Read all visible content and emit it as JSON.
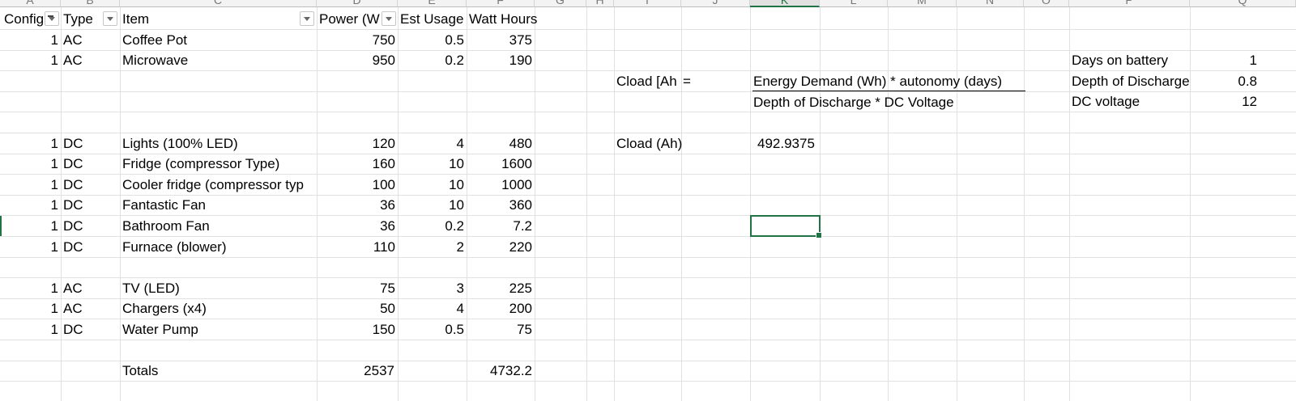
{
  "column_letters": [
    "A",
    "B",
    "C",
    "D",
    "E",
    "F",
    "G",
    "H",
    "I",
    "J",
    "K",
    "L",
    "M",
    "N",
    "O",
    "P",
    "Q"
  ],
  "headers": {
    "config": "Config",
    "type": "Type",
    "item": "Item",
    "power": "Power (W",
    "est_usage": "Est Usage",
    "watt_hours": "Watt Hours"
  },
  "items_table": [
    {
      "config": "1",
      "type": "AC",
      "item": "Coffee Pot",
      "power": "750",
      "usage": "0.5",
      "wh": "375"
    },
    {
      "config": "1",
      "type": "AC",
      "item": "Microwave",
      "power": "950",
      "usage": "0.2",
      "wh": "190"
    },
    {
      "config": "1",
      "type": "DC",
      "item": "Lights (100% LED)",
      "power": "120",
      "usage": "4",
      "wh": "480"
    },
    {
      "config": "1",
      "type": "DC",
      "item": "Fridge (compressor Type)",
      "power": "160",
      "usage": "10",
      "wh": "1600"
    },
    {
      "config": "1",
      "type": "DC",
      "item": "Cooler fridge (compressor typ",
      "power": "100",
      "usage": "10",
      "wh": "1000"
    },
    {
      "config": "1",
      "type": "DC",
      "item": "Fantastic Fan",
      "power": "36",
      "usage": "10",
      "wh": "360"
    },
    {
      "config": "1",
      "type": "DC",
      "item": "Bathroom Fan",
      "power": "36",
      "usage": "0.2",
      "wh": "7.2"
    },
    {
      "config": "1",
      "type": "DC",
      "item": "Furnace (blower)",
      "power": "110",
      "usage": "2",
      "wh": "220"
    },
    {
      "config": "1",
      "type": "AC",
      "item": "TV (LED)",
      "power": "75",
      "usage": "3",
      "wh": "225"
    },
    {
      "config": "1",
      "type": "AC",
      "item": "Chargers (x4)",
      "power": "50",
      "usage": "4",
      "wh": "200"
    },
    {
      "config": "1",
      "type": "DC",
      "item": "Water Pump",
      "power": "150",
      "usage": "0.5",
      "wh": "75"
    }
  ],
  "totals": {
    "label": "Totals",
    "power": "2537",
    "wh": "4732.2"
  },
  "formula": {
    "cload_label": "Cload [Ah",
    "equals": "=",
    "numerator": "Energy Demand (Wh) * autonomy (days)",
    "denominator": "Depth of Discharge * DC Voltage",
    "result_label": "Cload (Ah)",
    "result_value": "492.9375"
  },
  "params": [
    {
      "label": "Days on battery",
      "value": "1"
    },
    {
      "label": "Depth of Discharge",
      "value": "0.8"
    },
    {
      "label": "DC voltage",
      "value": "12"
    }
  ],
  "colors": {
    "grid": "#e1e1e1",
    "selection": "#217346"
  }
}
